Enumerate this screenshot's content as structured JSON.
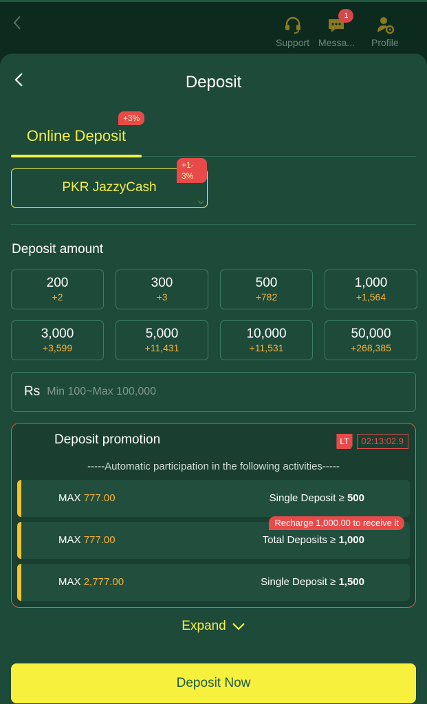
{
  "topbar": {
    "items": [
      {
        "label": "Support",
        "icon": "headset-icon"
      },
      {
        "label": "Messa...",
        "icon": "message-icon",
        "badge": "1"
      },
      {
        "label": "Profile",
        "icon": "profile-gear-icon"
      }
    ]
  },
  "sheet": {
    "title": "Deposit",
    "tab": {
      "label": "Online Deposit",
      "promo": "+3%"
    },
    "method": {
      "label": "PKR JazzyCash",
      "promo": "+1-3%"
    },
    "amount_heading": "Deposit amount",
    "amounts": [
      {
        "value": "200",
        "bonus": "+2"
      },
      {
        "value": "300",
        "bonus": "+3"
      },
      {
        "value": "500",
        "bonus": "+782"
      },
      {
        "value": "1,000",
        "bonus": "+1,564"
      },
      {
        "value": "3,000",
        "bonus": "+3,599"
      },
      {
        "value": "5,000",
        "bonus": "+11,431"
      },
      {
        "value": "10,000",
        "bonus": "+11,531"
      },
      {
        "value": "50,000",
        "bonus": "+268,385"
      }
    ],
    "input": {
      "currency": "Rs",
      "placeholder": "Min 100~Max 100,000"
    },
    "promotion": {
      "title": "Deposit promotion",
      "timer_tag": "LT",
      "timer": "02:13:02.9",
      "subtitle": "-----Automatic participation in the following activities-----",
      "rows": [
        {
          "max_label": "MAX",
          "max_value": "777.00",
          "condition": "Single Deposit ≥",
          "threshold": "500",
          "pill": ""
        },
        {
          "max_label": "MAX",
          "max_value": "777.00",
          "condition": "Total Deposits ≥",
          "threshold": "1,000",
          "pill": "Recharge 1,000.00 to receive it"
        },
        {
          "max_label": "MAX",
          "max_value": "2,777.00",
          "condition": "Single Deposit ≥",
          "threshold": "1,500",
          "pill": ""
        }
      ]
    },
    "expand_label": "Expand",
    "submit_label": "Deposit Now"
  },
  "colors": {
    "accent": "#f2ef46",
    "bonus": "#f5b23a",
    "panel": "#1e4a3a",
    "alert": "#e84a4a"
  }
}
